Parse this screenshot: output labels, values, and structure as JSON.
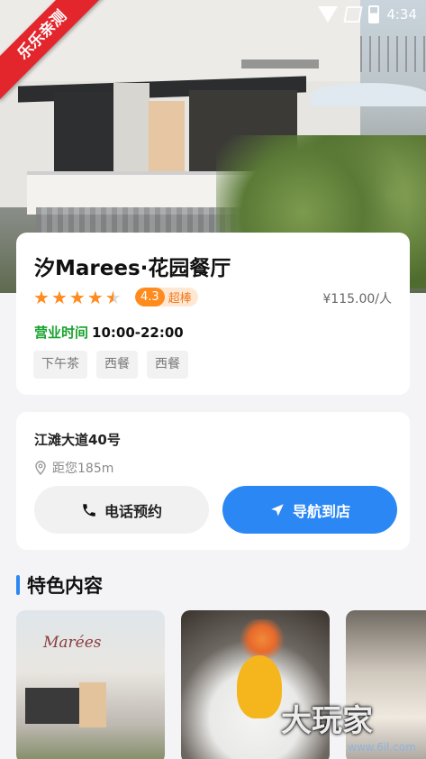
{
  "ribbon": {
    "text": "乐乐亲测"
  },
  "status_bar": {
    "time": "4:34"
  },
  "restaurant": {
    "name": "汐Marees·花园餐厅",
    "rating": 4.3,
    "rating_value": "4.3",
    "rating_label": "超棒",
    "price": "¥115.00/人",
    "hours_label": "营业时间",
    "hours": "10:00-22:00",
    "tags": [
      "下午茶",
      "西餐",
      "西餐"
    ]
  },
  "location": {
    "address": "江滩大道40号",
    "distance": "距您185m",
    "call_button": "电话预约",
    "nav_button": "导航到店"
  },
  "featured": {
    "title": "特色内容",
    "thumb1_logo": "Marées"
  },
  "watermark": {
    "text": "大玩家",
    "url": "www.6il.com"
  },
  "colors": {
    "accent_blue": "#2b87f4",
    "star_orange": "#ff8a1e",
    "hours_green": "#19a32e",
    "ribbon_red": "#e3252c"
  }
}
